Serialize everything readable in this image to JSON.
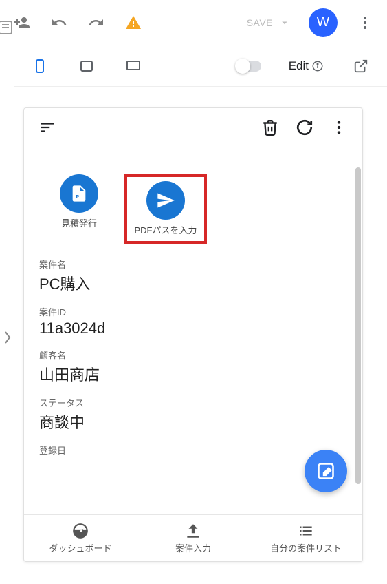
{
  "topbar": {
    "save_label": "SAVE",
    "avatar_letter": "W"
  },
  "device_bar": {
    "edit_label": "Edit"
  },
  "actions": [
    {
      "label": "見積発行",
      "icon": "file-pdf"
    },
    {
      "label": "PDFパスを入力",
      "icon": "paper-plane"
    }
  ],
  "fields": [
    {
      "label": "案件名",
      "value": "PC購入"
    },
    {
      "label": "案件ID",
      "value": "11a3024d"
    },
    {
      "label": "顧客名",
      "value": "山田商店"
    },
    {
      "label": "ステータス",
      "value": "商談中"
    },
    {
      "label": "登録日",
      "value": ""
    }
  ],
  "bottom_nav": [
    {
      "label": "ダッシュボード"
    },
    {
      "label": "案件入力"
    },
    {
      "label": "自分の案件リスト"
    }
  ]
}
